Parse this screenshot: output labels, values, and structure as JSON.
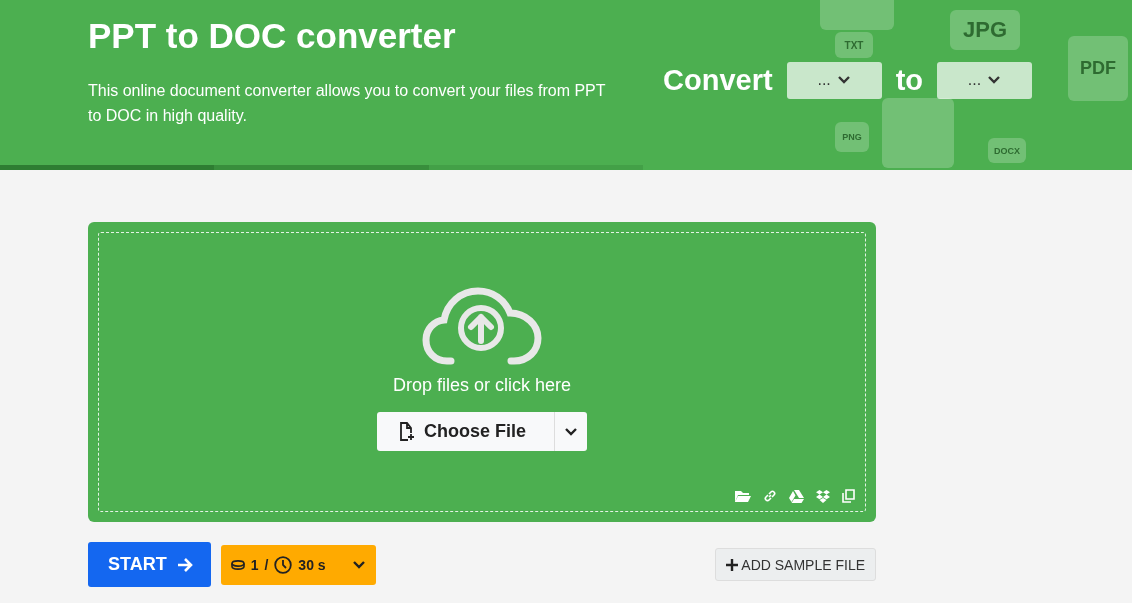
{
  "header": {
    "title": "PPT to DOC converter",
    "description": "This online document converter allows you to convert your files from PPT to DOC in high quality.",
    "convert_label": "Convert",
    "from_select": {
      "value": "..."
    },
    "to_label": "to",
    "to_select": {
      "value": "..."
    },
    "background_labels": [
      "JPG",
      "PDF",
      "TXT",
      "PNG",
      "DOCX"
    ]
  },
  "uploader": {
    "prompt": "Drop files or click here",
    "choose_button": "Choose File"
  },
  "actions": {
    "start_button": "START",
    "credits": "1",
    "separator": "/",
    "time": "30 s",
    "sample_button": "ADD SAMPLE FILE"
  }
}
